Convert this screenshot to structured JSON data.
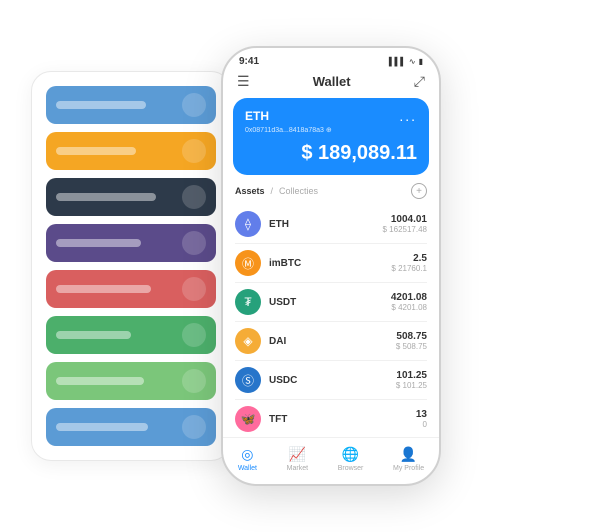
{
  "scene": {
    "cards": [
      {
        "color": "#5B9BD5",
        "textWidth": 90
      },
      {
        "color": "#F5A623",
        "textWidth": 80
      },
      {
        "color": "#2D3A4A",
        "textWidth": 100
      },
      {
        "color": "#5B4B8A",
        "textWidth": 85
      },
      {
        "color": "#D95F5F",
        "textWidth": 95
      },
      {
        "color": "#4CAF6B",
        "textWidth": 75
      },
      {
        "color": "#7BC67A",
        "textWidth": 88
      },
      {
        "color": "#5B9BD5",
        "textWidth": 92
      }
    ]
  },
  "phone": {
    "status": {
      "time": "9:41",
      "signal": "▌▌▌",
      "wifi": "WiFi",
      "battery": "🔋"
    },
    "header": {
      "menu_icon": "☰",
      "title": "Wallet",
      "expand_icon": "⤢"
    },
    "eth_card": {
      "title": "ETH",
      "address": "0x08711d3a...8418a78a3 ⊕",
      "more": "...",
      "balance": "$ 189,089.11",
      "dollar_sign": "$"
    },
    "assets": {
      "active_tab": "Assets",
      "divider": "/",
      "inactive_tab": "Collecties",
      "add_icon": "+"
    },
    "asset_list": [
      {
        "name": "ETH",
        "icon": "⟠",
        "icon_bg": "#627EEA",
        "amount": "1004.01",
        "usd": "$ 162517.48"
      },
      {
        "name": "imBTC",
        "icon": "Ⓜ",
        "icon_bg": "#F7931A",
        "amount": "2.5",
        "usd": "$ 21760.1"
      },
      {
        "name": "USDT",
        "icon": "₮",
        "icon_bg": "#26A17B",
        "amount": "4201.08",
        "usd": "$ 4201.08"
      },
      {
        "name": "DAI",
        "icon": "◈",
        "icon_bg": "#F5AC37",
        "amount": "508.75",
        "usd": "$ 508.75"
      },
      {
        "name": "USDC",
        "icon": "Ⓢ",
        "icon_bg": "#2775CA",
        "amount": "101.25",
        "usd": "$ 101.25"
      },
      {
        "name": "TFT",
        "icon": "🦋",
        "icon_bg": "#FF6B9D",
        "amount": "13",
        "usd": "0"
      }
    ],
    "nav": [
      {
        "icon": "◎",
        "label": "Wallet",
        "active": true
      },
      {
        "icon": "📈",
        "label": "Market",
        "active": false
      },
      {
        "icon": "🌐",
        "label": "Browser",
        "active": false
      },
      {
        "icon": "👤",
        "label": "My Profile",
        "active": false
      }
    ]
  }
}
